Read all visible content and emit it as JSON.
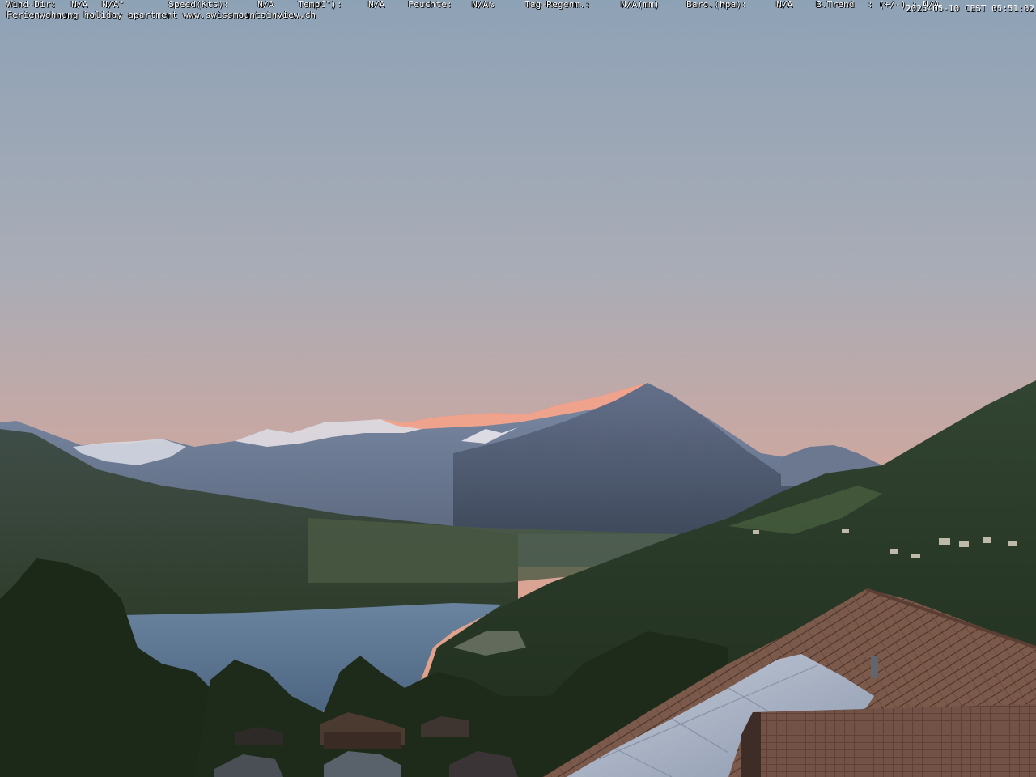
{
  "overlay": {
    "wind_dir_label": "Wind-Dir:",
    "wind_dir_value": "N/A",
    "wind_dir_deg": "N/A°",
    "speed_label": "Speed(Kts):",
    "speed_value": "N/A",
    "temp_label": "TempC°):",
    "temp_value": "N/A",
    "humidity_label": "Feuchte:",
    "humidity_value": "N/A%",
    "rain_label": "Tag-Regenm.:",
    "rain_value": "N/A(mm)",
    "baro_label": "Baro.(hpa):",
    "baro_value": "N/A",
    "trend_label": "B.Trend",
    "trend_value": ": (+/-) : N/A",
    "caption": "Ferienwohnung holiday apartment www.swissmountainview.ch",
    "timestamp": "2025-05-10 CEST 05:51:02"
  },
  "colors": {
    "sky_top": "#8fa3b8",
    "sky_bottom": "#e3a58e",
    "peak_glow": "#f0a48a",
    "lake": "#5a7490",
    "forest": "#2c3a24"
  }
}
